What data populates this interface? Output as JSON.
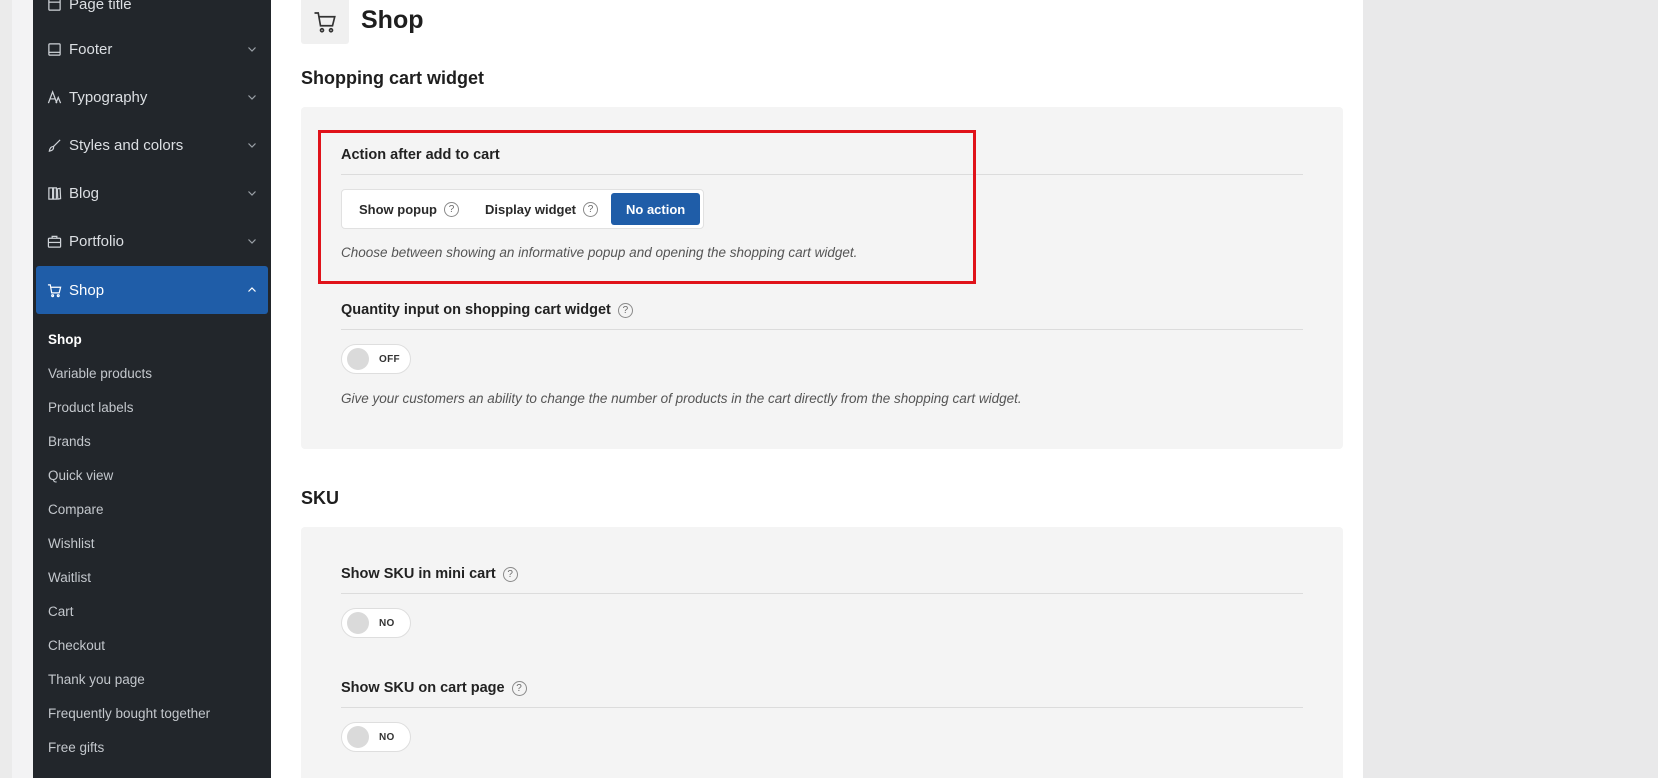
{
  "sidebar": {
    "items": [
      {
        "label": "Page title",
        "icon": "page-icon"
      },
      {
        "label": "Footer",
        "icon": "footer-icon"
      },
      {
        "label": "Typography",
        "icon": "typography-icon"
      },
      {
        "label": "Styles and colors",
        "icon": "brush-icon"
      },
      {
        "label": "Blog",
        "icon": "blog-icon"
      },
      {
        "label": "Portfolio",
        "icon": "portfolio-icon"
      },
      {
        "label": "Shop",
        "icon": "cart-icon",
        "active": true
      }
    ],
    "sub_items": [
      "Shop",
      "Variable products",
      "Product labels",
      "Brands",
      "Quick view",
      "Compare",
      "Wishlist",
      "Waitlist",
      "Cart",
      "Checkout",
      "Thank you page",
      "Frequently bought together",
      "Free gifts"
    ]
  },
  "page": {
    "title": "Shop",
    "icon": "cart-icon"
  },
  "shopping_cart_widget": {
    "section_title": "Shopping cart widget",
    "action_after_add": {
      "title": "Action after add to cart",
      "options": [
        "Show popup",
        "Display widget",
        "No action"
      ],
      "selected": "No action",
      "description": "Choose between showing an informative popup and opening the shopping cart widget."
    },
    "quantity_input": {
      "title": "Quantity input on shopping cart widget",
      "toggle_label": "OFF",
      "description": "Give your customers an ability to change the number of products in the cart directly from the shopping cart widget."
    }
  },
  "sku": {
    "section_title": "SKU",
    "mini_cart": {
      "title": "Show SKU in mini cart",
      "toggle_label": "NO"
    },
    "cart_page": {
      "title": "Show SKU on cart page",
      "toggle_label": "NO"
    }
  },
  "help_glyph": "?",
  "colors": {
    "accent": "#1f5da8",
    "sidebar_bg": "#22262b",
    "highlight": "#e0121a"
  }
}
